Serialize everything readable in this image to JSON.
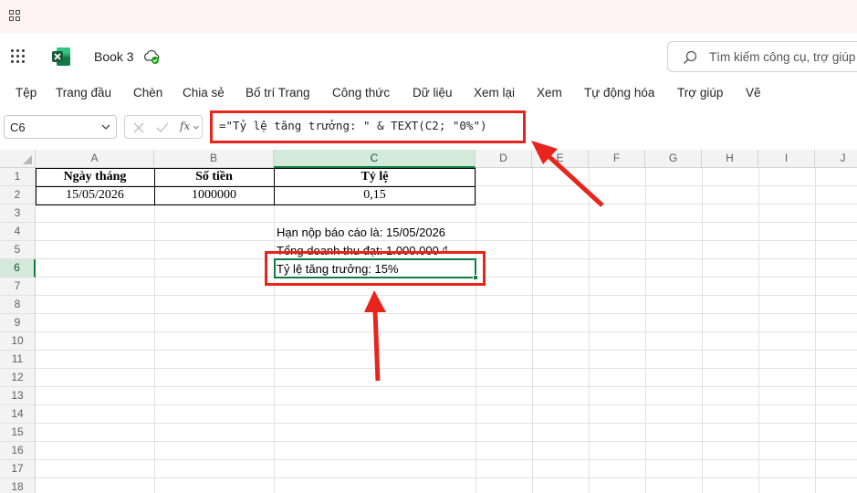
{
  "app": {
    "title": "Book 3",
    "search_placeholder": "Tìm kiếm công cụ, trợ giúp",
    "brand_color": "#107c41",
    "annotation_color": "#e8251c"
  },
  "menu": [
    "Tệp",
    "Trang đầu",
    "Chèn",
    "Chia sẻ",
    "Bố trí Trang",
    "Công thức",
    "Dữ liệu",
    "Xem lại",
    "Xem",
    "Tự động hóa",
    "Trợ giúp",
    "Vẽ"
  ],
  "formula_bar": {
    "name_box": "C6",
    "fx_label": "fx",
    "formula": "=\"Tỷ lệ tăng trưởng: \" & TEXT(C2; \"0%\")"
  },
  "grid": {
    "columns": [
      "A",
      "B",
      "C",
      "D",
      "E",
      "F",
      "G",
      "H",
      "I",
      "J"
    ],
    "rows": [
      "1",
      "2",
      "3",
      "4",
      "5",
      "6",
      "7",
      "8",
      "9",
      "10",
      "11",
      "12",
      "13",
      "14",
      "15",
      "16",
      "17",
      "18"
    ],
    "selected_column": "C",
    "selected_row": "6"
  },
  "cells": {
    "A1": "Ngày tháng",
    "B1": "Số tiền",
    "C1": "Tỷ lệ",
    "A2": "15/05/2026",
    "B2": "1000000",
    "C2": "0,15",
    "C4": "Hạn nộp báo cáo là: 15/05/2026",
    "C5": "Tổng doanh thu đạt: 1.000.000 ₫",
    "C6": "Tỷ lệ tăng trưởng: 15%"
  }
}
